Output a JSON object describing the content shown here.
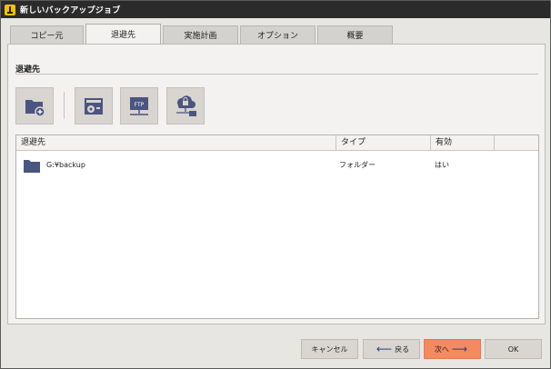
{
  "window": {
    "title": "新しいバックアップジョブ"
  },
  "tabs": [
    {
      "label": "コピー元",
      "active": false
    },
    {
      "label": "退避先",
      "active": true
    },
    {
      "label": "実施計画",
      "active": false
    },
    {
      "label": "オプション",
      "active": false
    },
    {
      "label": "概要",
      "active": false
    }
  ],
  "section": {
    "title": "退避先"
  },
  "toolbar": [
    {
      "icon": "add-folder-icon"
    },
    {
      "icon": "disk-icon"
    },
    {
      "icon": "ftp-icon"
    },
    {
      "icon": "cloud-network-icon"
    }
  ],
  "table": {
    "columns": [
      "退避先",
      "タイプ",
      "有効"
    ],
    "rows": [
      {
        "icon": "folder-icon",
        "destination": "G:¥backup",
        "type": "フォルダー",
        "enabled": "はい"
      }
    ]
  },
  "footer": {
    "cancel_label": "キャンセル",
    "back_label": "戻る",
    "next_label": "次へ",
    "ok_label": "OK"
  },
  "colors": {
    "titlebar": "#2b2b2b",
    "icon_blue": "#4a5580",
    "primary_button": "#f48a5e",
    "arrow": "#2b3e7a"
  }
}
